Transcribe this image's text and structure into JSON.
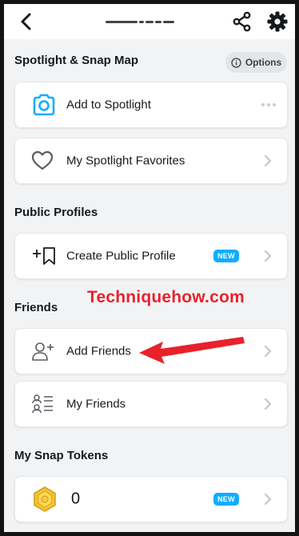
{
  "sections": {
    "spotlight": "Spotlight & Snap Map",
    "public_profiles": "Public Profiles",
    "friends": "Friends",
    "snap_tokens": "My Snap Tokens"
  },
  "options_label": "Options",
  "items": {
    "add_to_spotlight": "Add to Spotlight",
    "spotlight_favorites": "My Spotlight Favorites",
    "create_public_profile": "Create Public Profile",
    "add_friends": "Add Friends",
    "my_friends": "My Friends",
    "tokens_count": "0"
  },
  "badges": {
    "new": "NEW"
  },
  "watermark": "Techniquehow.com",
  "colors": {
    "accent": "#0fadff",
    "annotation_arrow": "#e8212a"
  }
}
